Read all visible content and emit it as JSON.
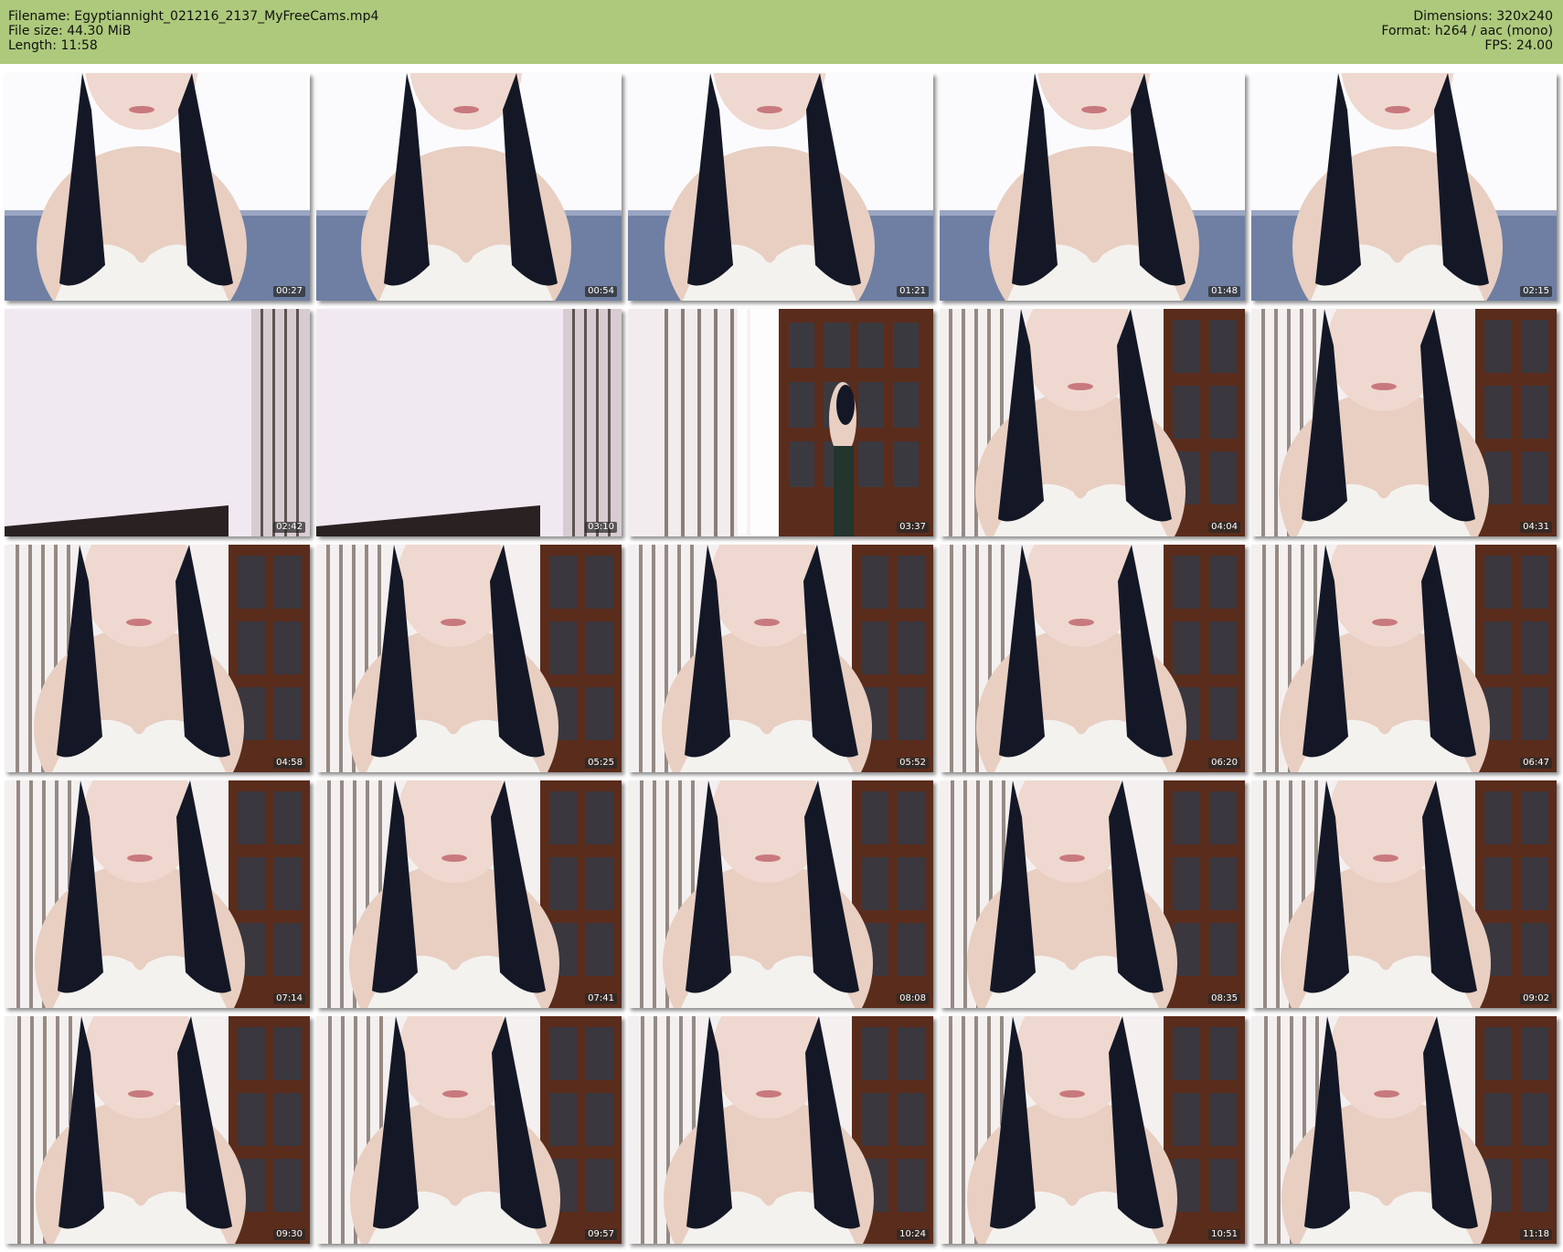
{
  "header": {
    "filename": "Filename: Egyptiannight_021216_2137_MyFreeCams.mp4",
    "filesize": "File size: 44.30 MiB",
    "length": "Length: 11:58",
    "dimensions": "Dimensions: 320x240",
    "format": "Format: h264 / aac (mono)",
    "fps": "FPS: 24.00"
  },
  "thumbnails": [
    {
      "time": "00:27",
      "scene": "wall-sea"
    },
    {
      "time": "00:54",
      "scene": "wall-sea"
    },
    {
      "time": "01:21",
      "scene": "wall-sea"
    },
    {
      "time": "01:48",
      "scene": "wall-sea"
    },
    {
      "time": "02:15",
      "scene": "wall-sea"
    },
    {
      "time": "02:42",
      "scene": "empty-wall"
    },
    {
      "time": "03:10",
      "scene": "empty-wall"
    },
    {
      "time": "03:37",
      "scene": "room-door"
    },
    {
      "time": "04:04",
      "scene": "room"
    },
    {
      "time": "04:31",
      "scene": "room"
    },
    {
      "time": "04:58",
      "scene": "room"
    },
    {
      "time": "05:25",
      "scene": "room"
    },
    {
      "time": "05:52",
      "scene": "room"
    },
    {
      "time": "06:20",
      "scene": "room"
    },
    {
      "time": "06:47",
      "scene": "room"
    },
    {
      "time": "07:14",
      "scene": "room"
    },
    {
      "time": "07:41",
      "scene": "room"
    },
    {
      "time": "08:08",
      "scene": "room"
    },
    {
      "time": "08:35",
      "scene": "room"
    },
    {
      "time": "09:02",
      "scene": "room"
    },
    {
      "time": "09:30",
      "scene": "room"
    },
    {
      "time": "09:57",
      "scene": "room"
    },
    {
      "time": "10:24",
      "scene": "room"
    },
    {
      "time": "10:51",
      "scene": "room"
    },
    {
      "time": "11:18",
      "scene": "room"
    }
  ],
  "colors": {
    "header_bg": "#adc97c",
    "hair": "#141826",
    "skin": "#e8cfc2",
    "bra": "#f4f2ee",
    "wall": "#f1e9f1",
    "sea": "#6e7fa3",
    "wood": "#5a2c1c"
  }
}
